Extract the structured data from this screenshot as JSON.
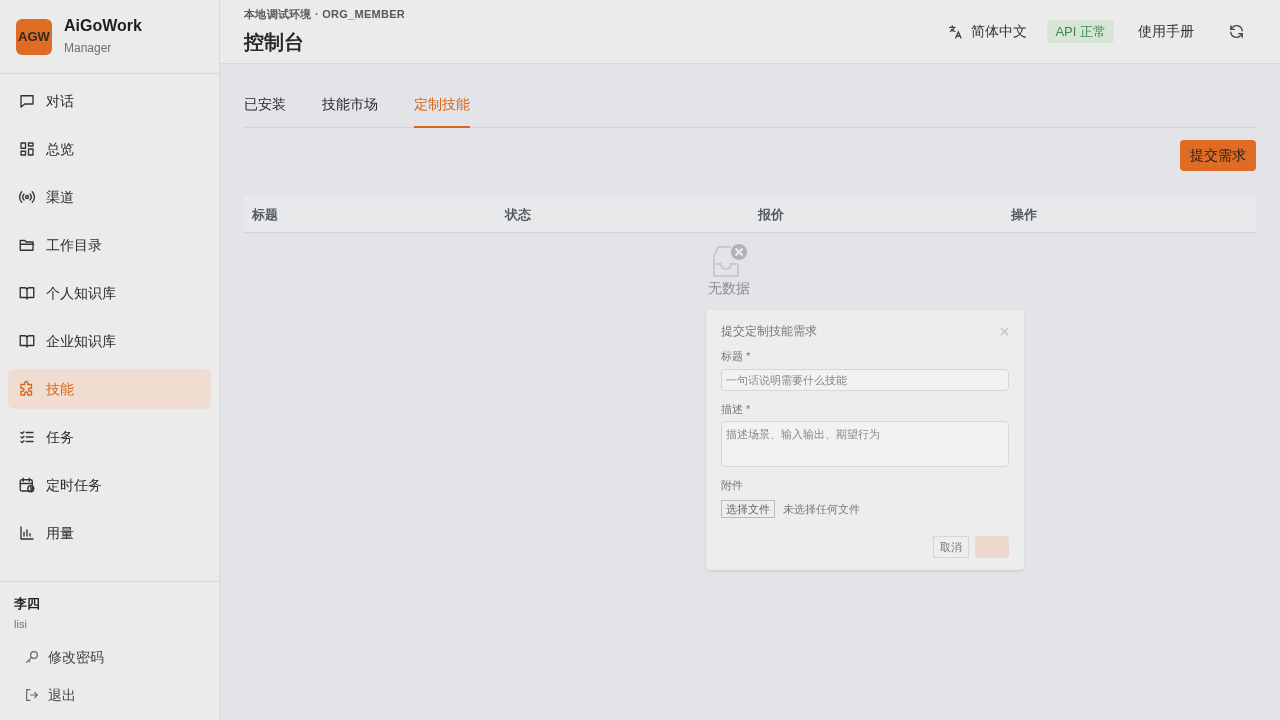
{
  "brand": {
    "logo": "AGW",
    "name": "AiGoWork",
    "role": "Manager"
  },
  "nav": [
    {
      "label": "对话",
      "selected": false
    },
    {
      "label": "总览",
      "selected": false
    },
    {
      "label": "渠道",
      "selected": false
    },
    {
      "label": "工作目录",
      "selected": false
    },
    {
      "label": "个人知识库",
      "selected": false
    },
    {
      "label": "企业知识库",
      "selected": false
    },
    {
      "label": "技能",
      "selected": true
    },
    {
      "label": "任务",
      "selected": false
    },
    {
      "label": "定时任务",
      "selected": false
    },
    {
      "label": "用量",
      "selected": false
    }
  ],
  "user": {
    "name": "李四",
    "username": "lisi",
    "actions": [
      "修改密码",
      "退出"
    ]
  },
  "header": {
    "breadcrumb": "本地调试环境 · ORG_MEMBER",
    "title": "控制台",
    "language": "简体中文",
    "api_status": "API 正常",
    "manual": "使用手册"
  },
  "tabs": [
    {
      "label": "已安装",
      "selected": false
    },
    {
      "label": "技能市场",
      "selected": false
    },
    {
      "label": "定制技能",
      "selected": true
    }
  ],
  "submit_button": "提交需求",
  "table": {
    "columns": [
      "标题",
      "状态",
      "报价",
      "操作"
    ],
    "empty_text": "无数据"
  },
  "dialog": {
    "title": "提交定制技能需求",
    "title_label": "标题 *",
    "title_placeholder": "一句话说明需要什么技能",
    "description_label": "描述 *",
    "description_placeholder": "描述场景、输入输出、期望行为",
    "attachment_label": "附件",
    "file_button": "选择文件",
    "file_status": "未选择任何文件",
    "cancel": "取消"
  }
}
